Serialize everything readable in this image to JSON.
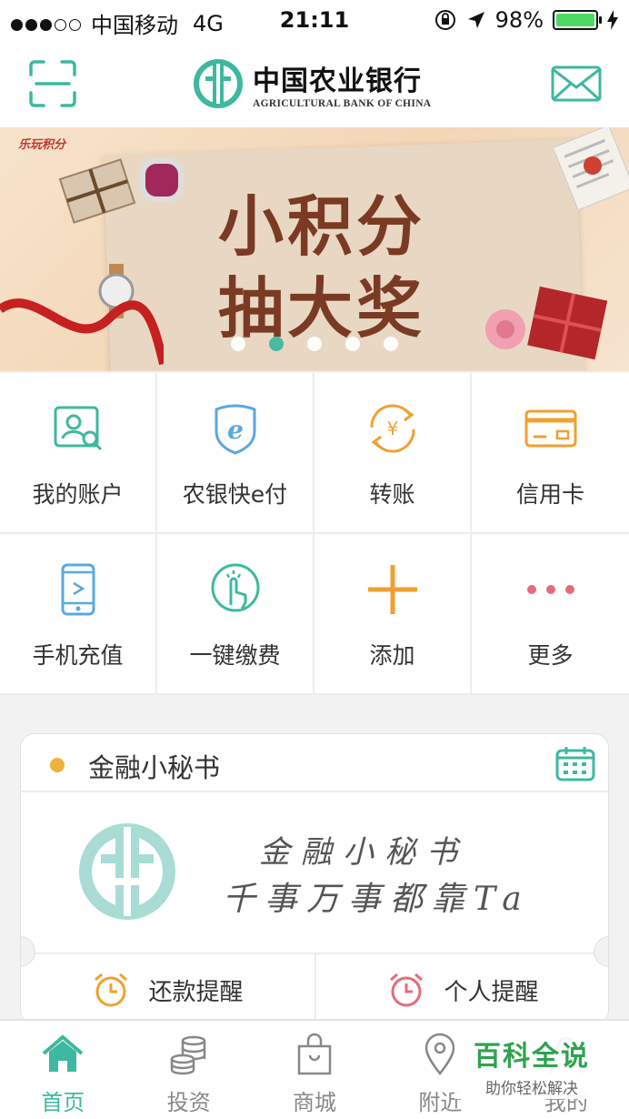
{
  "status_bar": {
    "carrier": "中国移动",
    "network": "4G",
    "time": "21:11",
    "battery": "98%"
  },
  "header": {
    "brand_cn": "中国农业银行",
    "brand_en": "AGRICULTURAL BANK OF CHINA"
  },
  "banner": {
    "promo_tag": "乐玩积分",
    "line1": "小积分",
    "line2": "抽大奖",
    "pages": 5,
    "active_page": 2
  },
  "grid": [
    {
      "label": "我的账户",
      "icon": "account-icon"
    },
    {
      "label": "农银快e付",
      "icon": "e-pay-icon"
    },
    {
      "label": "转账",
      "icon": "transfer-icon"
    },
    {
      "label": "信用卡",
      "icon": "credit-card-icon"
    },
    {
      "label": "手机充值",
      "icon": "phone-topup-icon"
    },
    {
      "label": "一键缴费",
      "icon": "one-tap-pay-icon"
    },
    {
      "label": "添加",
      "icon": "plus-icon"
    },
    {
      "label": "更多",
      "icon": "more-icon"
    }
  ],
  "assistant": {
    "title": "金融小秘书",
    "handwriting_line1": "金融小秘书",
    "handwriting_line2": "千事万事都靠Ta",
    "reminders": [
      "还款提醒",
      "个人提醒"
    ]
  },
  "tabs": [
    "首页",
    "投资",
    "商城",
    "附近",
    "我的"
  ],
  "active_tab": "首页",
  "watermark": {
    "title": "百科全说",
    "subtitle": "助你轻松解决"
  },
  "colors": {
    "accent": "#3eb8a0",
    "orange": "#f0a030",
    "pink": "#e86a7a",
    "blue": "#5aa8e0"
  }
}
